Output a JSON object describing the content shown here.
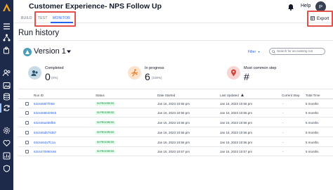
{
  "app": {
    "title": "Customer Experience- NPS Follow Up",
    "help": "Help",
    "avatar_initial": "P"
  },
  "tabs": [
    "BUILD",
    "TEST",
    "MONITOR"
  ],
  "active_tab": "MONITOR",
  "toolbar": {
    "export_label": "Export"
  },
  "page": {
    "title": "Run history"
  },
  "version": {
    "label": "Version 1"
  },
  "filter": {
    "label": "Filter"
  },
  "search": {
    "placeholder": "Search for an existing run"
  },
  "stats": [
    {
      "title": "Completed",
      "value": "0",
      "sub": "(0%)",
      "icon": "check-circle-icon",
      "color": "#c9dbe6"
    },
    {
      "title": "In progress",
      "value": "6",
      "sub": "(100%)",
      "icon": "running-person-icon",
      "color": "#fde2cc"
    },
    {
      "title": "Most common step",
      "value": "#",
      "sub": "",
      "icon": "map-pin-icon",
      "color": "#f8d4d4"
    }
  ],
  "table": {
    "columns": [
      "Run ID",
      "Status",
      "Date Started",
      "Last Updated",
      "Current Step",
      "Total Time"
    ],
    "rows": [
      {
        "run_id": "63c6465f7f069",
        "status": "IN PROGRESS",
        "started": "Jan 16, 2023 10:55 pm",
        "updated": "Jan 16, 2023 10:55 pm",
        "step": "-",
        "total": "5 months"
      },
      {
        "run_id": "63c6468640915",
        "status": "IN PROGRESS",
        "started": "Jan 16, 2023 10:55 pm",
        "updated": "Jan 16, 2023 10:55 pm",
        "step": "-",
        "total": "5 months"
      },
      {
        "run_id": "63c646a455fb5",
        "status": "IN PROGRESS",
        "started": "Jan 16, 2023 10:56 pm",
        "updated": "Jan 16, 2023 10:56 pm",
        "step": "-",
        "total": "5 months"
      },
      {
        "run_id": "63c646d678387",
        "status": "IN PROGRESS",
        "started": "Jan 16, 2023 10:56 pm",
        "updated": "Jan 16, 2023 10:56 pm",
        "step": "-",
        "total": "5 months"
      },
      {
        "run_id": "63c6464a7fc1a",
        "status": "IN PROGRESS",
        "started": "Jan 16, 2023 10:56 pm",
        "updated": "Jan 16, 2023 10:56 pm",
        "step": "-",
        "total": "5 months"
      },
      {
        "run_id": "63c6470890c66",
        "status": "IN PROGRESS",
        "started": "Jan 16, 2023 10:57 pm",
        "updated": "Jan 16, 2023 10:57 pm",
        "step": "-",
        "total": "5 months"
      }
    ]
  },
  "colors": {
    "rail": "#1e2a4a",
    "accent": "#2563eb",
    "highlight": "#e0524a",
    "badge_bg": "#dcfce7",
    "badge_text": "#15803d"
  },
  "rail_icons": [
    "list-icon",
    "flow-icon",
    "puzzle-icon",
    "users-icon",
    "image-icon",
    "database-icon",
    "sync-icon",
    "gear-icon",
    "heart-icon",
    "chart-icon",
    "shield-icon"
  ]
}
